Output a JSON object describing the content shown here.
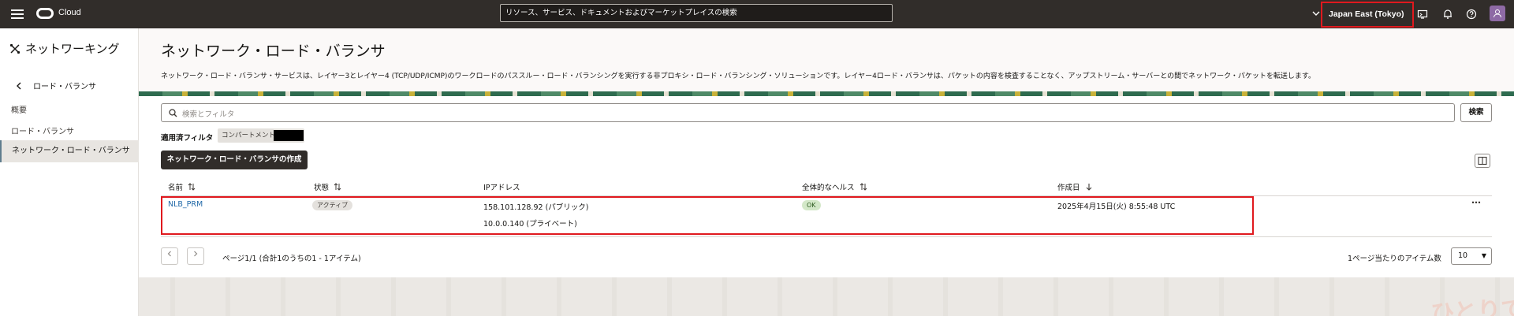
{
  "topbar": {
    "brand": "Cloud",
    "search_placeholder": "リソース、サービス、ドキュメントおよびマーケットプレイスの検索",
    "region": "Japan East (Tokyo)"
  },
  "sidebar": {
    "title": "ネットワーキング",
    "back_label": "ロード・バランサ",
    "items": [
      {
        "label": "概要"
      },
      {
        "label": "ロード・バランサ"
      }
    ],
    "active_item": "ネットワーク・ロード・バランサ"
  },
  "page": {
    "title": "ネットワーク・ロード・バランサ",
    "description": "ネットワーク・ロード・バランサ・サービスは、レイヤー3とレイヤー4 (TCP/UDP/ICMP)のワークロードのパススルー・ロード・バランシングを実行する非プロキシ・ロード・バランシング・ソリューションです。レイヤー4ロード・バランサは、パケットの内容を検査することなく、アップストリーム・サーバーとの間でネットワーク・パケットを転送します。"
  },
  "filter": {
    "placeholder": "検索とフィルタ",
    "search_button": "検索",
    "applied_label": "適用済フィルタ",
    "chip_label": "コンパートメント"
  },
  "create_button": "ネットワーク・ロード・バランサの作成",
  "table": {
    "headers": {
      "name": "名前",
      "state": "状態",
      "ip": "IPアドレス",
      "health": "全体的なヘルス",
      "created": "作成日"
    },
    "rows": [
      {
        "name": "NLB_PRM",
        "state": "アクティブ",
        "ip_public": "158.101.128.92 (パブリック)",
        "ip_private": "10.0.0.140 (プライベート)",
        "health": "OK",
        "created": "2025年4月15日(火) 8:55:48 UTC"
      }
    ]
  },
  "pagination": {
    "text": "ページ1/1 (合計1のうちの1 - 1アイテム)",
    "items_per_page_label": "1ページ当たりのアイテム数",
    "items_per_page": "10"
  },
  "watermark": "ひとりでできるもん",
  "colors": {
    "topbar": "#312d2a",
    "highlight": "#e0191e",
    "link": "#2169a8",
    "ok_badge": "#d3e8c8"
  }
}
